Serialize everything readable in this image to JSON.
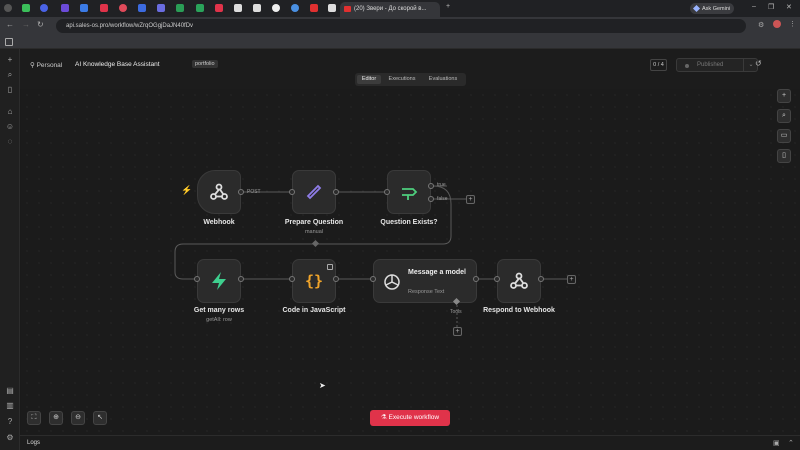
{
  "browser": {
    "active_tab_title": "(20) Звери - До скорой в...",
    "ask_gemini": "Ask Gemini",
    "url": "api.sales-os.pro/workflow/wZrqOGgjDaJN40fDv"
  },
  "header": {
    "workspace": "Personal",
    "workflow_name": "AI Knowledge Base Assistant",
    "tag": "portfolio",
    "counter": "0 / 4",
    "publish_label": "Published"
  },
  "view_tabs": [
    "Editor",
    "Executions",
    "Evaluations"
  ],
  "nodes": {
    "webhook": {
      "label": "Webhook"
    },
    "prepare": {
      "label": "Prepare Question",
      "sub": "manual"
    },
    "question_exists": {
      "label": "Question Exists?"
    },
    "get_rows": {
      "label": "Get many rows",
      "sub": "getAll: row"
    },
    "code": {
      "label": "Code in JavaScript"
    },
    "model": {
      "label": "Message a model",
      "sub": "Response Text"
    },
    "respond": {
      "label": "Respond to Webhook"
    }
  },
  "edge_labels": {
    "post": "POST",
    "true": "true",
    "false": "false",
    "tools": "Tools"
  },
  "execute_label": "Execute workflow",
  "logs_label": "Logs",
  "colors": {
    "accent_red": "#e0334a",
    "pen": "#8f7de8",
    "router": "#4ecf7e",
    "bolt": "#3ecf8e",
    "code": "#f0a42a"
  }
}
